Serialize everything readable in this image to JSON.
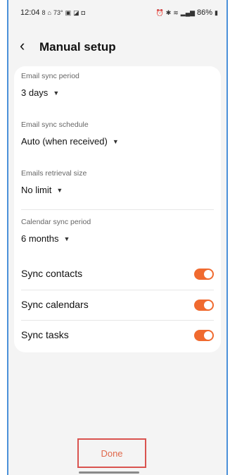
{
  "status_bar": {
    "time": "12:04",
    "left_icons": [
      "8",
      "home-icon",
      "73°",
      "gallery-icon",
      "message-icon",
      "bag-icon"
    ],
    "weather_text": "73°",
    "battery_text": "86%"
  },
  "header": {
    "title": "Manual setup"
  },
  "settings": {
    "email_sync_period": {
      "label": "Email sync period",
      "value": "3 days"
    },
    "email_sync_schedule": {
      "label": "Email sync schedule",
      "value": "Auto (when received)"
    },
    "emails_retrieval_size": {
      "label": "Emails retrieval size",
      "value": "No limit"
    },
    "calendar_sync_period": {
      "label": "Calendar sync period",
      "value": "6 months"
    },
    "toggles": [
      {
        "label": "Sync contacts",
        "on": true
      },
      {
        "label": "Sync calendars",
        "on": true
      },
      {
        "label": "Sync tasks",
        "on": true
      }
    ]
  },
  "footer": {
    "done_label": "Done"
  },
  "colors": {
    "accent": "#f06a2f",
    "background": "#f4f4f4",
    "card": "#ffffff"
  }
}
